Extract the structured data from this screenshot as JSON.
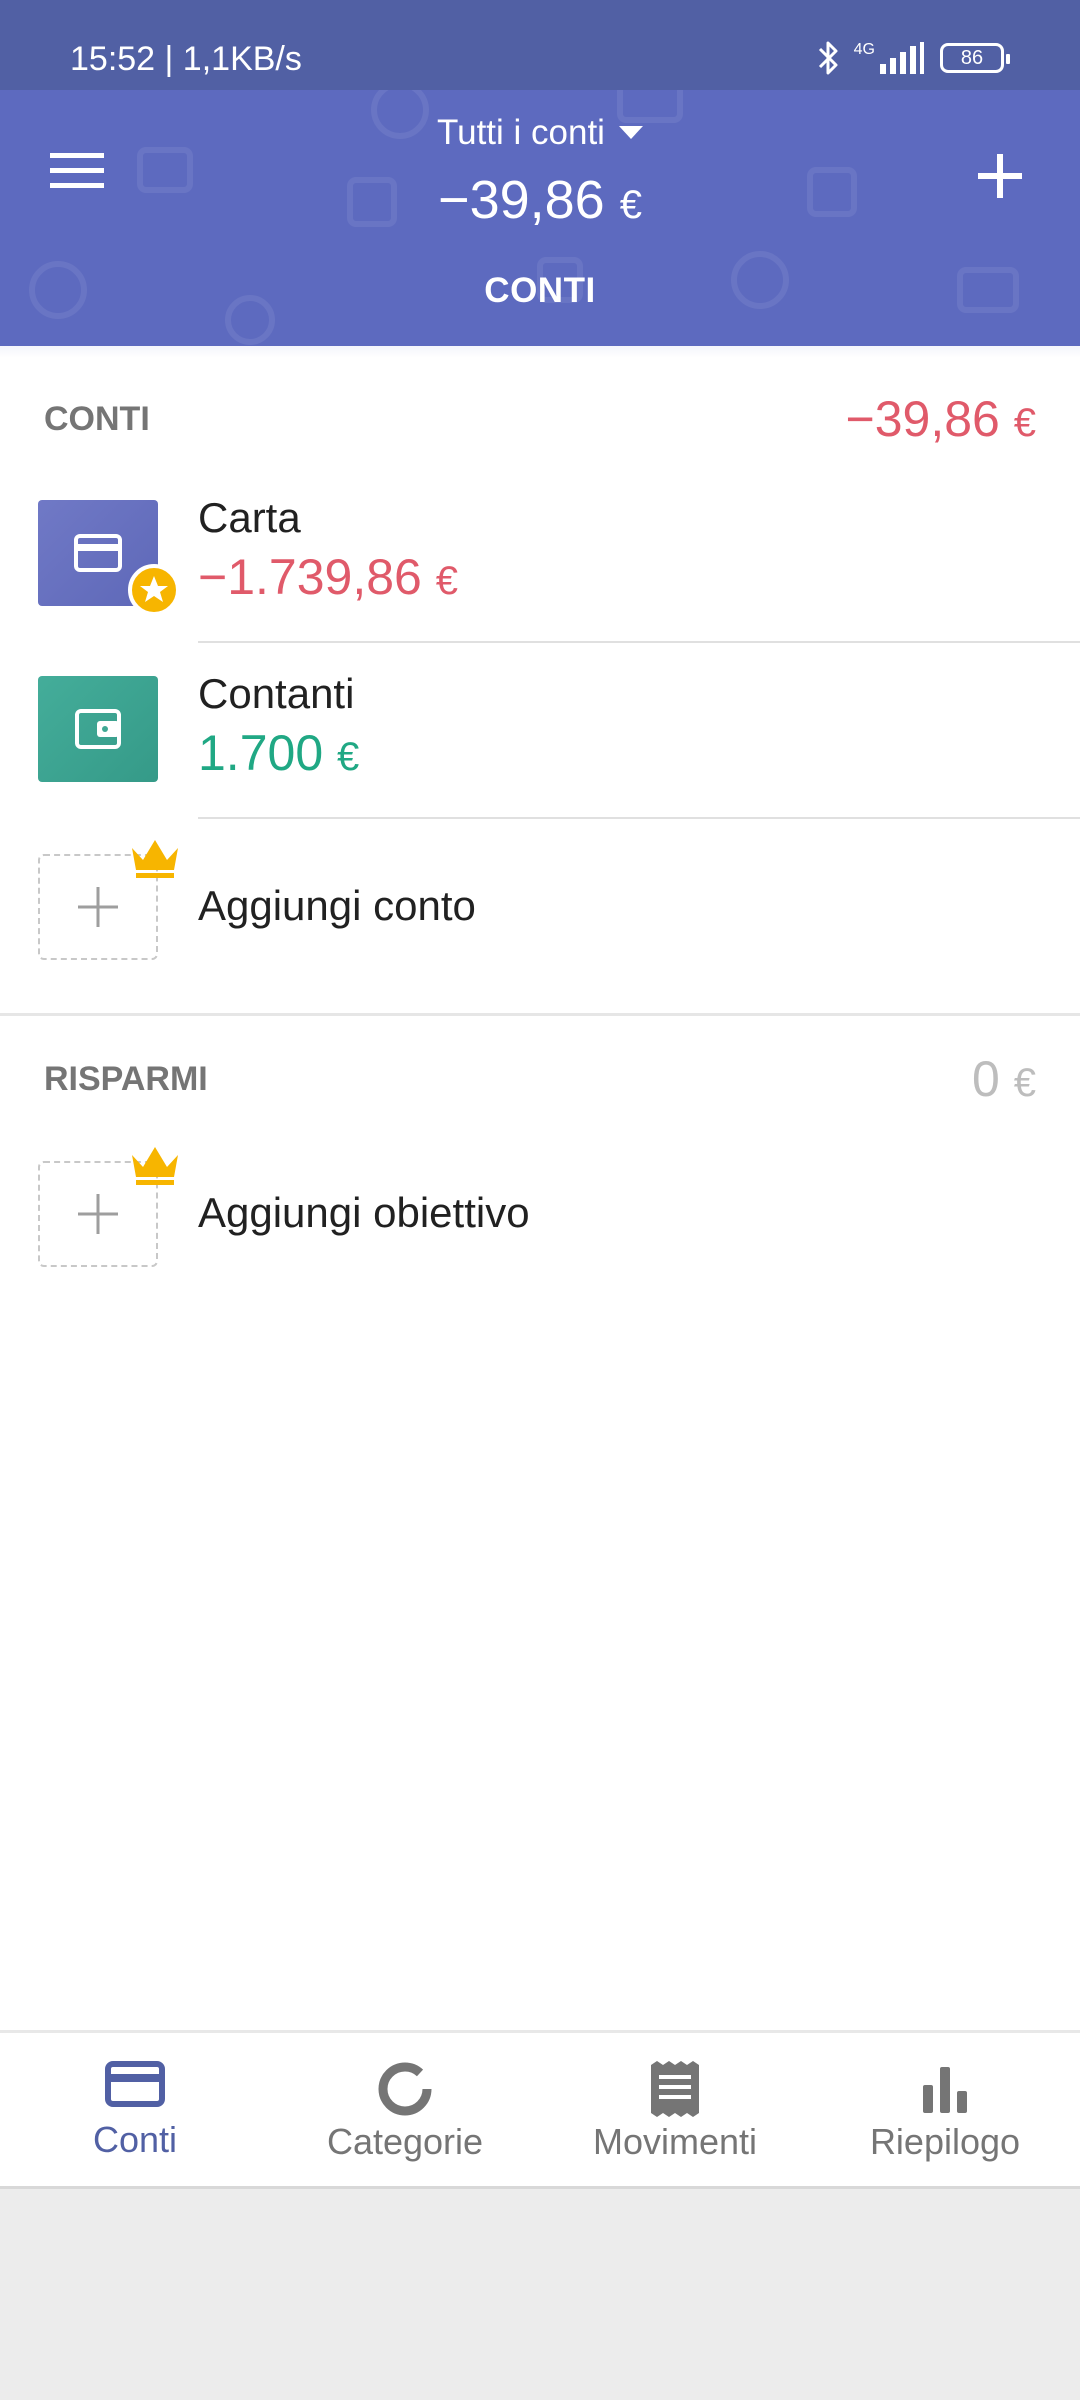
{
  "status_bar": {
    "time": "15:52 | 1,1KB/s",
    "network": "4G",
    "battery": "86",
    "icons": [
      "bluetooth-icon",
      "signal-icon",
      "battery-icon"
    ]
  },
  "header": {
    "account_selector": "Tutti i conti",
    "total_value": "−39,86",
    "currency": "€",
    "tab_label": "CONTI",
    "colors": {
      "header": "#5d6abf",
      "status_bar": "#5160a4"
    }
  },
  "accounts_section": {
    "label": "CONTI",
    "total_value": "−39,86",
    "currency": "€",
    "items": [
      {
        "name": "Carta",
        "amount": "−1.739,86",
        "currency": "€",
        "icon": "credit-card-icon",
        "badge": "star-badge-icon",
        "amount_color": "#e05a6a",
        "icon_color": "#6f78c8"
      },
      {
        "name": "Contanti",
        "amount": "1.700",
        "currency": "€",
        "icon": "wallet-icon",
        "amount_color": "#20a884",
        "icon_color": "#3fa894"
      }
    ],
    "add_label": "Aggiungi conto"
  },
  "savings_section": {
    "label": "RISPARMI",
    "total_value": "0",
    "currency": "€",
    "add_label": "Aggiungi obiettivo"
  },
  "bottom_nav": {
    "items": [
      {
        "label": "Conti",
        "icon": "card-icon",
        "active": true
      },
      {
        "label": "Categorie",
        "icon": "donut-icon",
        "active": false
      },
      {
        "label": "Movimenti",
        "icon": "receipt-icon",
        "active": false
      },
      {
        "label": "Riepilogo",
        "icon": "bar-chart-icon",
        "active": false
      }
    ],
    "active_color": "#5160a4",
    "inactive_color": "#757575"
  }
}
